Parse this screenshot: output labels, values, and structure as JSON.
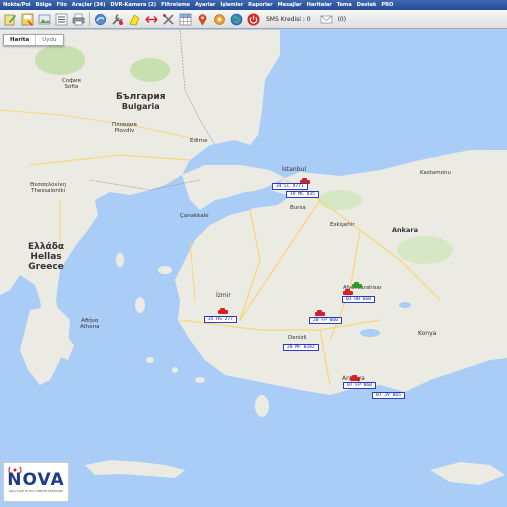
{
  "menu": [
    "Nokta/Poi",
    "Bölge",
    "Filo",
    "Araçlar (34)",
    "DVR-Kamera (2)",
    "Filtreleme",
    "Ayarlar",
    "İşlemler",
    "Raporlar",
    "Mesajlar",
    "Haritalar",
    "Tema",
    "Destek",
    "PRO"
  ],
  "toolbar": {
    "icons": [
      "edit-icon",
      "save-icon",
      "image-icon",
      "list-icon",
      "print-icon",
      "route-icon",
      "wrench-icon",
      "highlight-icon",
      "arrows-icon",
      "tools-icon",
      "grid-icon",
      "pin-icon",
      "gear-icon",
      "globe-icon",
      "power-icon"
    ],
    "sms_label": "SMS Kredisi : 0",
    "sms_count": "(0)"
  },
  "map": {
    "type_buttons": [
      "Harita",
      "Uydu"
    ],
    "country_labels": [
      "България",
      "Bulgaria",
      "Ελλάδα",
      "Hellas",
      "Greece"
    ],
    "city_labels": [
      "София",
      "Sofia",
      "Пловдив",
      "Plovdiv",
      "Θεσσαλονίκη",
      "Thessaloniki",
      "Αθήνα",
      "Athena",
      "İstanbul",
      "Ankara",
      "İzmir",
      "Bursa",
      "Eskişehir",
      "Konya",
      "Antalya",
      "Denizli",
      "Afyonkarahisar",
      "Çanakkale",
      "Edirne",
      "Kastamonu"
    ],
    "vehicles": [
      {
        "plate": "34 LL 9771",
        "color": "#1a3fd0"
      },
      {
        "plate": "19 MC 835",
        "color": "#1a3fd0"
      },
      {
        "plate": "03 UB 660",
        "color": "#1a3fd0"
      },
      {
        "plate": "35 HS 277",
        "color": "#1a3fd0"
      },
      {
        "plate": "20 FP 060",
        "color": "#1a3fd0"
      },
      {
        "plate": "20 MF 0282",
        "color": "#1a3fd0"
      },
      {
        "plate": "07 FP 060",
        "color": "#1a3fd0"
      },
      {
        "plate": "07 JV 065",
        "color": "#1a3fd0"
      }
    ]
  },
  "logo": {
    "name": "NOVA",
    "tagline": "ARAÇ TAKİP VE FİLO YÖNETİM SİSTEMLERİ"
  },
  "colors": {
    "menubar": "#2f58a3",
    "sea": "#a9cdf6",
    "land": "#ecebe3",
    "plate_border": "#2b3fc4"
  }
}
